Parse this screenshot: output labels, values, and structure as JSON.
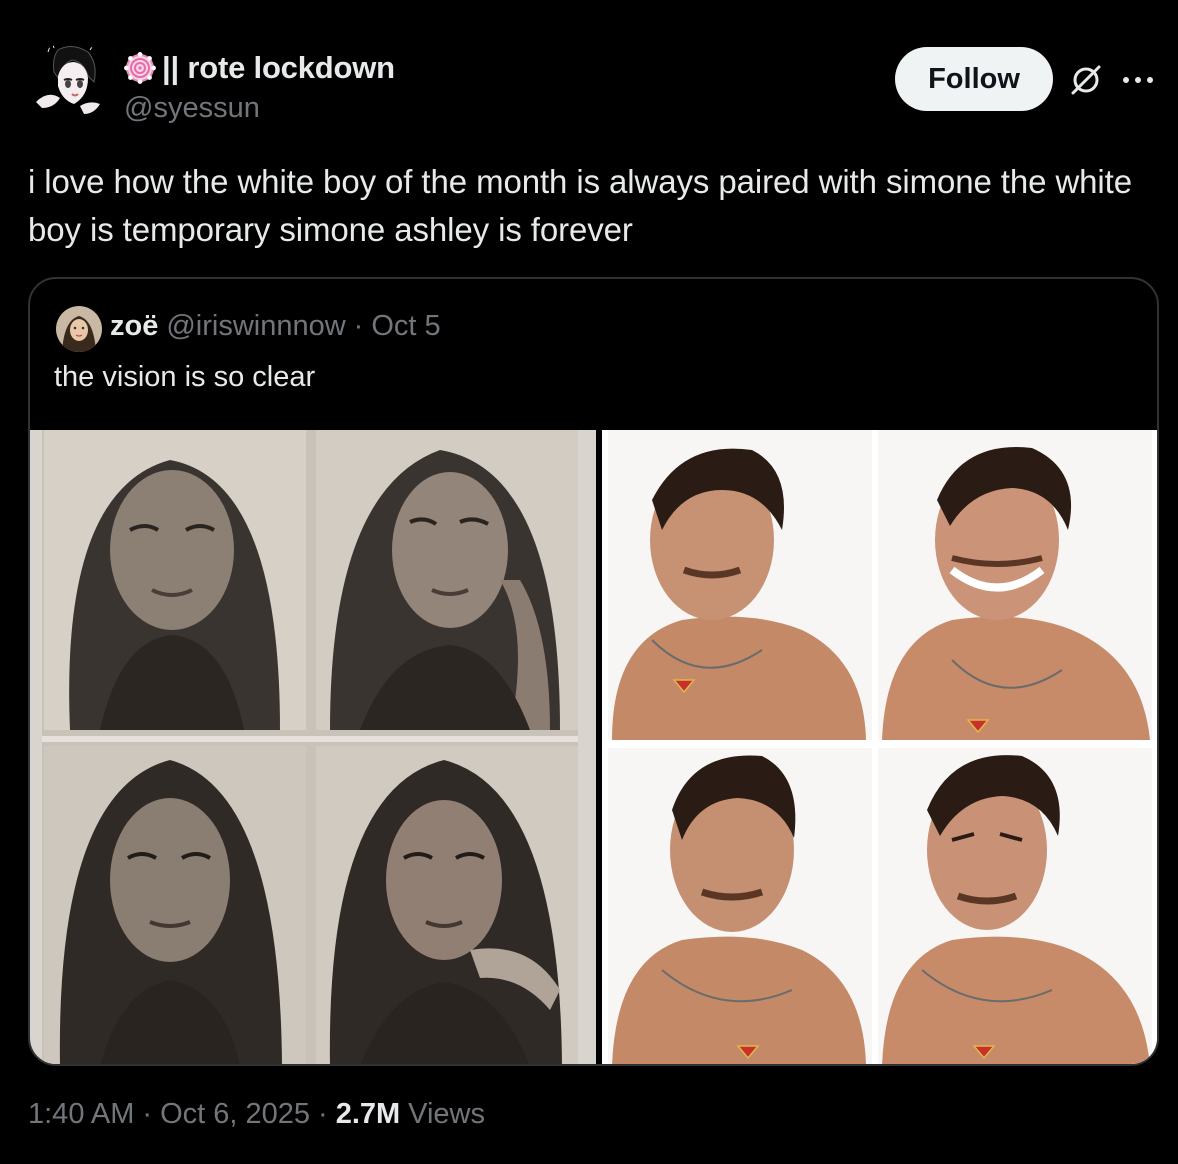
{
  "author": {
    "display_name": "|| rote lockdown",
    "handle": "@syessun",
    "emoji_icon": "swirl-lollipop-icon"
  },
  "actions": {
    "follow_label": "Follow",
    "grok_icon": "grok-icon",
    "more_icon": "more-icon"
  },
  "tweet": {
    "text": "i love how the white boy of the month is always paired with simone the white boy is temporary simone ashley is forever"
  },
  "quote": {
    "display_name": "zoë",
    "handle": "@iriswinnnow",
    "separator": "·",
    "date": "Oct 5",
    "text": "the vision is so clear"
  },
  "footer": {
    "time": "1:40 AM",
    "separator1": "·",
    "date": "Oct 6, 2025",
    "separator2": "·",
    "views_count": "2.7M",
    "views_label": "Views"
  },
  "colors": {
    "background": "#000000",
    "text_primary": "#e7e9ea",
    "text_secondary": "#71767b",
    "border": "#2f3336",
    "follow_bg": "#eff3f4"
  }
}
